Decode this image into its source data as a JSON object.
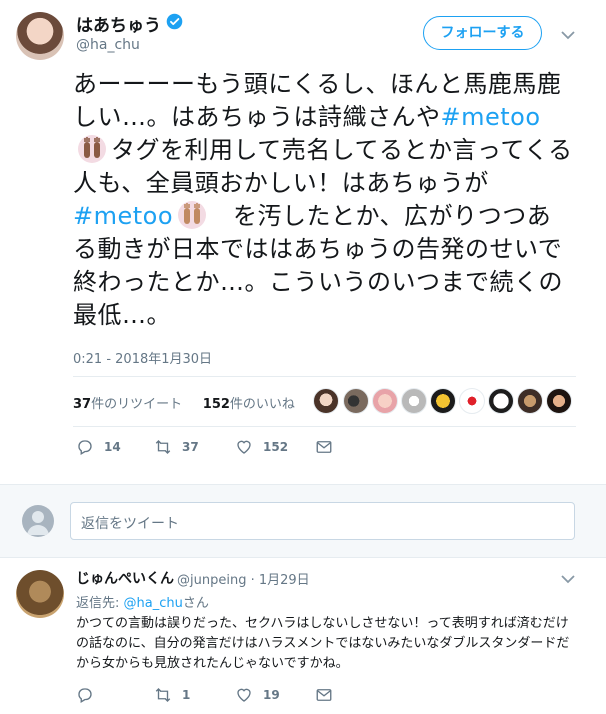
{
  "tweet": {
    "display_name": "はあちゅう",
    "handle": "@ha_chu",
    "follow_label": "フォローする",
    "text_parts": {
      "p1": "あーーーーもう頭にくるし、ほんと馬鹿馬鹿しい…。はあちゅうは詩織さんや",
      "hashtag1": "#metoo",
      "p2": "タグを利用して売名してるとか言ってくる人も、全員頭おかしい！はあちゅうが",
      "hashtag2": "#metoo",
      "p3": "を汚したとか、広がりつつある動きが日本でははあちゅうの告発のせいで終わったとか…。こういうのいつまで続くの最低…。"
    },
    "timestamp": "0:21 - 2018年1月30日",
    "stats": {
      "retweets_count": "37",
      "retweets_label": "件のリツイート",
      "likes_count": "152",
      "likes_label": "件のいいね"
    },
    "actions": {
      "reply_count": "14",
      "retweet_count": "37",
      "like_count": "152"
    }
  },
  "reply_box": {
    "placeholder": "返信をツイート"
  },
  "reply": {
    "display_name": "じゅんぺいくん",
    "handle": "@junpeing",
    "date": "· 1月29日",
    "reply_to_label": "返信先:",
    "reply_to_handle": "@ha_chu",
    "reply_to_suffix": "さん",
    "text": "かつての言動は誤りだった、セクハラはしないしさせない！って表明すれば済むだけの話なのに、自分の発言だけはハラスメントではないみたいなダブルスタンダードだから女からも見放されたんじゃないですかね。",
    "actions": {
      "reply_count": "",
      "retweet_count": "1",
      "like_count": "19"
    }
  },
  "colors": {
    "accent": "#1da1f2",
    "muted": "#657786",
    "text": "#14171a",
    "border": "#e6ecf0"
  }
}
